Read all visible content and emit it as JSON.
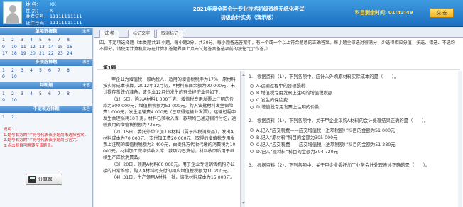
{
  "user": {
    "name_label": "姓 名：",
    "name": "XX",
    "gender_label": "性 别：",
    "gender": "X",
    "ticket_label": "准考证号：",
    "ticket": "11111111111",
    "id_label": "证件号码：",
    "id": "11111111111"
  },
  "header": {
    "title_line1": "2021年度全国会计专业技术初级资格无纸化考试",
    "title_line2": "初级会计实务（演示版）",
    "timer_label": "科目剩余时间:",
    "timer_value": "01:43:49",
    "submit_label": "交 卷"
  },
  "sidebar": {
    "sections": [
      {
        "title": "单项选择题",
        "count": "未答",
        "rows": [
          [
            "1",
            "2",
            "3",
            "4",
            "5",
            "6",
            "7",
            "8"
          ],
          [
            "9",
            "10",
            "11",
            "12",
            "13",
            "14",
            "15",
            "16"
          ],
          [
            "17",
            "18",
            "19",
            "20",
            "21",
            "22",
            "23",
            "24"
          ]
        ]
      },
      {
        "title": "多项选择题",
        "count": "未答",
        "rows": [
          [
            "1",
            "2",
            "3",
            "4",
            "5",
            "6",
            "7",
            "8"
          ],
          [
            "9",
            "10"
          ]
        ]
      },
      {
        "title": "判断题",
        "count": "未答",
        "rows": [
          [
            "1",
            "2",
            "3",
            "4",
            "5",
            "6",
            "7",
            "8"
          ],
          [
            "9",
            "10"
          ]
        ]
      },
      {
        "title": "不定项选择题",
        "count": "未答",
        "rows": [
          [
            "1",
            "2"
          ]
        ]
      }
    ],
    "legend_title": "说明：",
    "legend_lines": [
      "1.题号右方的“’”符号代表该小题尚未选择答案。",
      "2.题号右方的“’”符号代表该小题尚已答完。",
      "3.点击题目可跳转至该题目。"
    ],
    "calculator_label": "计算器"
  },
  "tabs": [
    "试 卷",
    "标记文字",
    "取消标记"
  ],
  "instruction": "四、不定项选择题（本类题共15小题，每小题2分，共30分。每小题备选答案中，有一个或一个以上符合题意的正确答案。每小题全部选对得满分，少选得相应分值，多选、错选、不选均不得分。请使用计算机鼠标在计算机答题界面上点击试题答案备选项前的按钮“□”作答。）",
  "question_number": "第1题",
  "material": [
    "甲企业为增值税一般纳税人，适用的增值税税率为17%，原材料按实际成本核算。2012年12月初，A材料账面余额为90 000元，未计提存货跌价准备，该企业12月份发生的有关经济业务如下：",
    "（1）5日，购入A材料1 000千克，增值税专用发票上注明的价款为300 000元，增值税税额为51 000元，购入该批材料发生保险费1 000元，发生运输费4 000元（已取得运输业发票），运输过程中发生合理损耗10千克，材料已验收入库，款项均已通过银行付讫，运输费用的增值税税额为735元。",
    "（2）15日，委托外单位加工B材料（属于应税消费品），发出A材料成本为70 000元，支付加工费20 000元，取得的增值税专用发票上注明的增值税税额为3 400元，由受托方代收代缴的消费税为10 000元，材料加工完毕验收入库，款项均已支付，材料收回后用于继续生产应税消费品。",
    "（3）20日，领用A材料60 000元，用于企业专设销售机构办公楼的日常维修，购入A材料时支付的相应增值税税额为10 200元。",
    "（4）31日，生产领用A材料一批，该批材料成本为15 000元。"
  ],
  "questions": [
    {
      "number": "1.",
      "stem": "根据资料（1），下列各项中，应计入外购原材料实际成本的是（　　）。",
      "options": [
        {
          "letter": "A.",
          "text": "运输过程中的合理损耗"
        },
        {
          "letter": "B.",
          "text": "增值税专用发票上注明的增值税税额"
        },
        {
          "letter": "C.",
          "text": "发生的保险费"
        },
        {
          "letter": "D.",
          "text": "增值税专用发票上注明的价款"
        }
      ]
    },
    {
      "number": "2.",
      "stem": "根据资料（1），下列各项中，关于甲企业采购A材料的会计处理结果正确的是（　　）。",
      "options": [
        {
          "letter": "A.",
          "text": "记入“应交税费——应交增值税（进项税额）”科目的金额为51 000元"
        },
        {
          "letter": "B.",
          "text": "记入“原材料”科目的金额为305 000元"
        },
        {
          "letter": "C.",
          "text": "记入“应交税费——应交增值税（进项税额）”科目的金额为51 280元"
        },
        {
          "letter": "D.",
          "text": "记入“原材料”科目的金额为304 720元"
        }
      ]
    },
    {
      "number": "3.",
      "stem": "根据资料（2），下列各项中，关于甲企业委托加工业务会计处理表述正确的是（　　）。",
      "options": []
    }
  ]
}
